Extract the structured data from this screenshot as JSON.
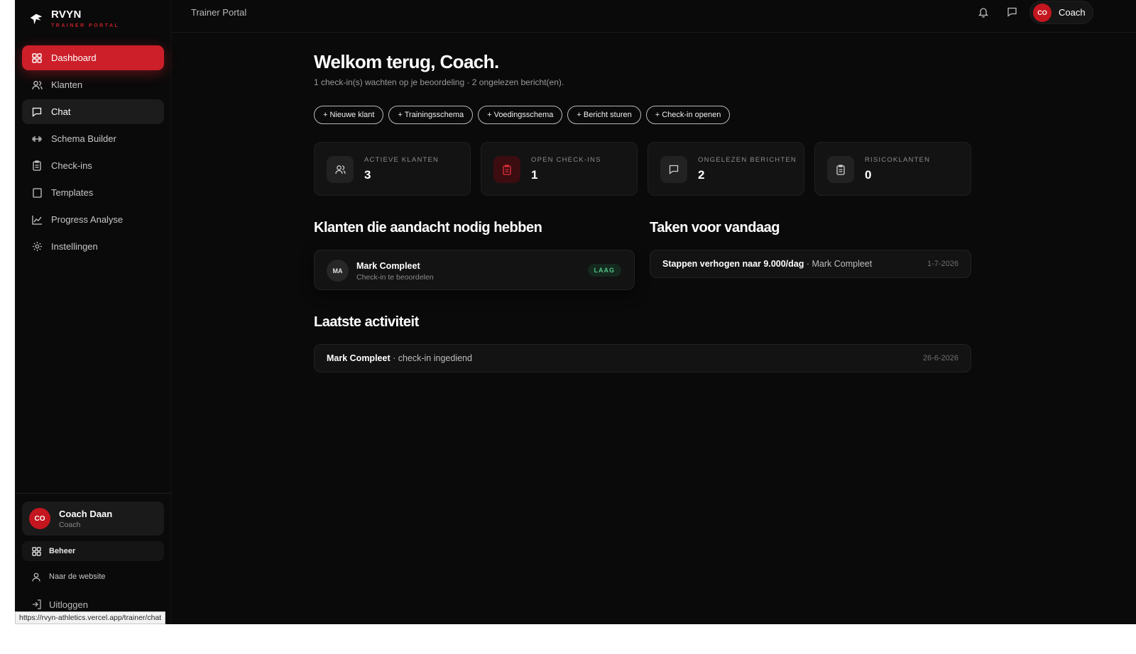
{
  "brand": {
    "name": "RVYN",
    "subtitle": "TRAINER PORTAL"
  },
  "sidebar": {
    "items": [
      {
        "label": "Dashboard",
        "icon": "grid-icon"
      },
      {
        "label": "Klanten",
        "icon": "users-icon"
      },
      {
        "label": "Chat",
        "icon": "chat-icon"
      },
      {
        "label": "Schema Builder",
        "icon": "dumbbell-icon"
      },
      {
        "label": "Check-ins",
        "icon": "clipboard-icon"
      },
      {
        "label": "Templates",
        "icon": "template-icon"
      },
      {
        "label": "Progress Analyse",
        "icon": "chart-icon"
      },
      {
        "label": "Instellingen",
        "icon": "gear-icon"
      }
    ],
    "user": {
      "initials": "CO",
      "name": "Coach Daan",
      "role": "Coach"
    },
    "beheer": "Beheer",
    "website": "Naar de website",
    "logout": "Uitloggen"
  },
  "topbar": {
    "title": "Trainer Portal",
    "profile_initials": "CO",
    "profile_label": "Coach"
  },
  "main": {
    "welcome": "Welkom terug, Coach.",
    "subline": "1 check-in(s) wachten op je beoordeling · 2 ongelezen bericht(en).",
    "quick_actions": [
      "+ Nieuwe klant",
      "+ Trainingsschema",
      "+ Voedingsschema",
      "+ Bericht sturen",
      "+ Check-in openen"
    ],
    "stats": [
      {
        "label": "ACTIEVE KLANTEN",
        "value": "3"
      },
      {
        "label": "OPEN CHECK-INS",
        "value": "1"
      },
      {
        "label": "ONGELEZEN BERICHTEN",
        "value": "2"
      },
      {
        "label": "RISICOKLANTEN",
        "value": "0"
      }
    ],
    "attention": {
      "title": "Klanten die aandacht nodig hebben",
      "client": {
        "initials": "MA",
        "name": "Mark Compleet",
        "sub": "Check-in te beoordelen",
        "badge": "LAAG"
      }
    },
    "tasks": {
      "title": "Taken voor vandaag",
      "item": {
        "task": "Stappen verhogen naar 9.000/dag",
        "client": " · Mark Compleet",
        "date": "1-7-2026"
      }
    },
    "activity": {
      "title": "Laatste activiteit",
      "item": {
        "name": "Mark Compleet",
        "action": " · check-in ingediend",
        "date": "26-6-2026"
      }
    }
  },
  "status_bar": {
    "url": "https://rvyn-athletics.vercel.app/trainer/chat"
  },
  "colors": {
    "accent": "#cc1f2a",
    "background": "#0a0a0a",
    "card": "#131313",
    "badge_green": "#4fc486"
  }
}
